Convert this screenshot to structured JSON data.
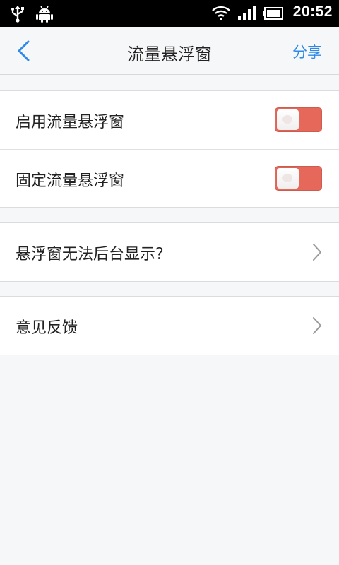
{
  "status_bar": {
    "time": "20:52",
    "icons": [
      "usb-icon",
      "android-icon",
      "wifi-icon",
      "signal-icon",
      "battery-icon"
    ]
  },
  "header": {
    "title": "流量悬浮窗",
    "back_icon": "chevron-left-icon",
    "share_label": "分享"
  },
  "settings": {
    "toggles": [
      {
        "label": "启用流量悬浮窗",
        "enabled": true
      },
      {
        "label": "固定流量悬浮窗",
        "enabled": true
      }
    ],
    "help_label": "悬浮窗无法后台显示？",
    "feedback_label": "意见反馈"
  },
  "colors": {
    "accent": "#2e8ae6",
    "toggle_on": "#e5685a",
    "background": "#f6f7f9"
  }
}
